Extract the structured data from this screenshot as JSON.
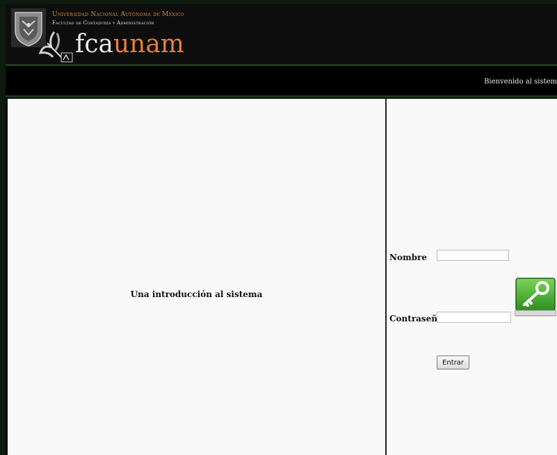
{
  "header": {
    "university": "Universidad Nacional Autónoma de México",
    "faculty": "Facultad de Contaduría y Administración",
    "brand_part1": "fca",
    "brand_part2": "unam"
  },
  "nav": {
    "welcome": "Bienvenido al sistem"
  },
  "main": {
    "intro": "Una introducción al sistema"
  },
  "login": {
    "name_label": "Nombre",
    "name_value": "",
    "password_label": "Contraseña",
    "password_value": "",
    "submit_label": "Entrar",
    "key_icon": "key-icon"
  },
  "colors": {
    "accent_orange": "#e87f3a",
    "header_bg": "#0c0d0c",
    "content_bg": "#f9f9f9",
    "key_green": "#3fae2a"
  }
}
